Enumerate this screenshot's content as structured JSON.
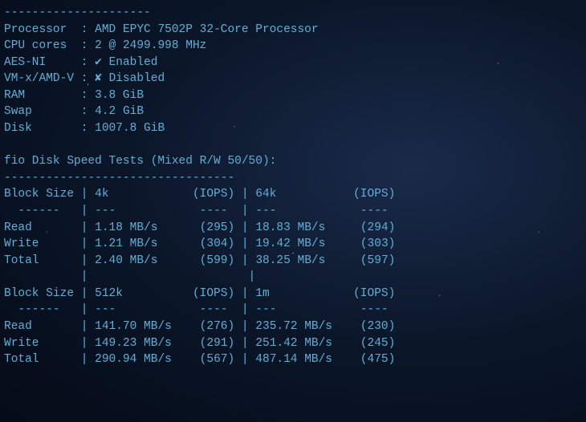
{
  "dashes_top": "---------------------",
  "sys": {
    "processor_label": "Processor",
    "processor_value": "AMD EPYC 7502P 32-Core Processor",
    "cpu_cores_label": "CPU cores",
    "cpu_cores_value": "2 @ 2499.998 MHz",
    "aes_ni_label": "AES-NI",
    "aes_ni_value": "Enabled",
    "vmx_label": "VM-x/AMD-V",
    "vmx_value": "Disabled",
    "ram_label": "RAM",
    "ram_value": "3.8 GiB",
    "swap_label": "Swap",
    "swap_value": "4.2 GiB",
    "disk_label": "Disk",
    "disk_value": "1007.8 GiB"
  },
  "fio_title": "fio Disk Speed Tests (Mixed R/W 50/50):",
  "fio_dashes": "---------------------------------",
  "headers": {
    "block_size": "Block Size",
    "iops": "(IOPS)",
    "read": "Read",
    "write": "Write",
    "total": "Total"
  },
  "table1": {
    "col1": "4k",
    "col2": "64k",
    "read1": "1.18 MB/s",
    "read1_iops": "(295)",
    "read2": "18.83 MB/s",
    "read2_iops": "(294)",
    "write1": "1.21 MB/s",
    "write1_iops": "(304)",
    "write2": "19.42 MB/s",
    "write2_iops": "(303)",
    "total1": "2.40 MB/s",
    "total1_iops": "(599)",
    "total2": "38.25 MB/s",
    "total2_iops": "(597)"
  },
  "table2": {
    "col1": "512k",
    "col2": "1m",
    "read1": "141.70 MB/s",
    "read1_iops": "(276)",
    "read2": "235.72 MB/s",
    "read2_iops": "(230)",
    "write1": "149.23 MB/s",
    "write1_iops": "(291)",
    "write2": "251.42 MB/s",
    "write2_iops": "(245)",
    "total1": "290.94 MB/s",
    "total1_iops": "(567)",
    "total2": "487.14 MB/s",
    "total2_iops": "(475)"
  },
  "sep": {
    "dash6": "------",
    "dash3": "---",
    "dash4": "----"
  }
}
